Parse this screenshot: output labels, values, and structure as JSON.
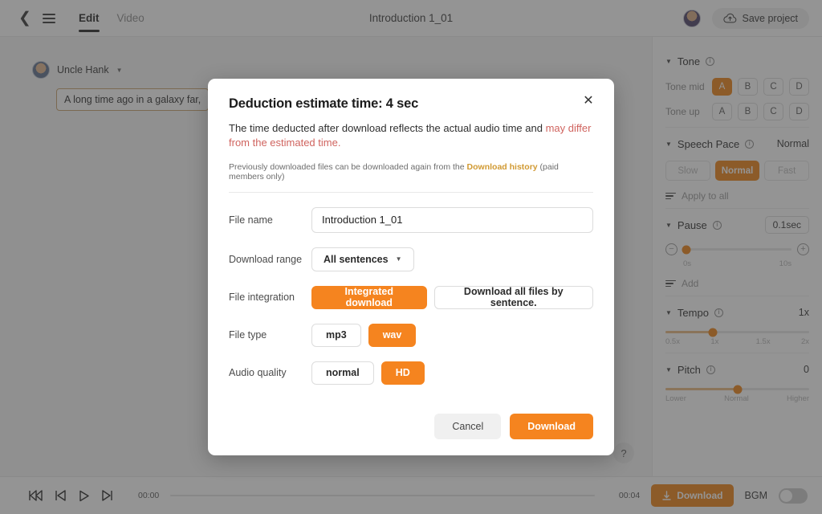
{
  "topbar": {
    "back_icon": "chevron-left-icon",
    "menu_icon": "hamburger-menu-icon",
    "tabs": [
      {
        "label": "Edit",
        "active": true
      },
      {
        "label": "Video",
        "active": false
      }
    ],
    "document_title": "Introduction 1_01",
    "save_label": "Save project",
    "save_icon": "cloud-upload-icon"
  },
  "canvas": {
    "speaker_name": "Uncle Hank",
    "sentence_text": "A long time ago in a galaxy far,",
    "help_label": "?"
  },
  "sidebar": {
    "tone": {
      "title": "Tone",
      "rows": [
        {
          "label": "Tone mid",
          "options": [
            "A",
            "B",
            "C",
            "D"
          ],
          "selected": "A"
        },
        {
          "label": "Tone up",
          "options": [
            "A",
            "B",
            "C",
            "D"
          ],
          "selected": ""
        }
      ]
    },
    "speech_pace": {
      "title": "Speech Pace",
      "value": "Normal",
      "options": [
        "Slow",
        "Normal",
        "Fast"
      ],
      "selected": "Normal",
      "apply_all_label": "Apply to all"
    },
    "pause": {
      "title": "Pause",
      "value": "0.1sec",
      "min_label": "0s",
      "max_label": "10s",
      "knob_percent": 3,
      "add_label": "Add",
      "minus_icon": "minus-circle-icon",
      "plus_icon": "plus-circle-icon"
    },
    "tempo": {
      "title": "Tempo",
      "value": "1x",
      "ticks": [
        "0.5x",
        "1x",
        "1.5x",
        "2x"
      ],
      "knob_percent": 33
    },
    "pitch": {
      "title": "Pitch",
      "value": "0",
      "ticks": [
        "Lower",
        "Normal",
        "Higher"
      ],
      "knob_percent": 50
    }
  },
  "bottombar": {
    "transport": [
      "skip-to-start-icon",
      "step-back-icon",
      "play-icon",
      "step-forward-icon"
    ],
    "time_start": "00:00",
    "time_end": "00:04",
    "download_label": "Download",
    "download_icon": "download-icon",
    "bgm_label": "BGM",
    "bgm_on": false
  },
  "modal": {
    "title": "Deduction estimate time: 4 sec",
    "close_icon": "close-icon",
    "desc_normal": "The time deducted after download reflects the actual audio time and ",
    "desc_warn": "may differ from the estimated time.",
    "sub_pre": "Previously downloaded files can be downloaded again from the ",
    "sub_link": "Download history",
    "sub_post": " (paid members only)",
    "fields": {
      "file_name_label": "File name",
      "file_name_value": "Introduction 1_01",
      "download_range_label": "Download range",
      "download_range_value": "All sentences",
      "file_integration_label": "File integration",
      "file_integration_options": [
        "Integrated download",
        "Download all files by sentence."
      ],
      "file_integration_selected": "Integrated download",
      "file_type_label": "File type",
      "file_type_options": [
        "mp3",
        "wav"
      ],
      "file_type_selected": "wav",
      "audio_quality_label": "Audio quality",
      "audio_quality_options": [
        "normal",
        "HD"
      ],
      "audio_quality_selected": "HD"
    },
    "cancel_label": "Cancel",
    "download_label": "Download"
  },
  "colors": {
    "accent_orange": "#F5841F",
    "sidebar_orange": "#EE8012",
    "warn_red": "#d0645f",
    "link_gold": "#d19a33"
  }
}
